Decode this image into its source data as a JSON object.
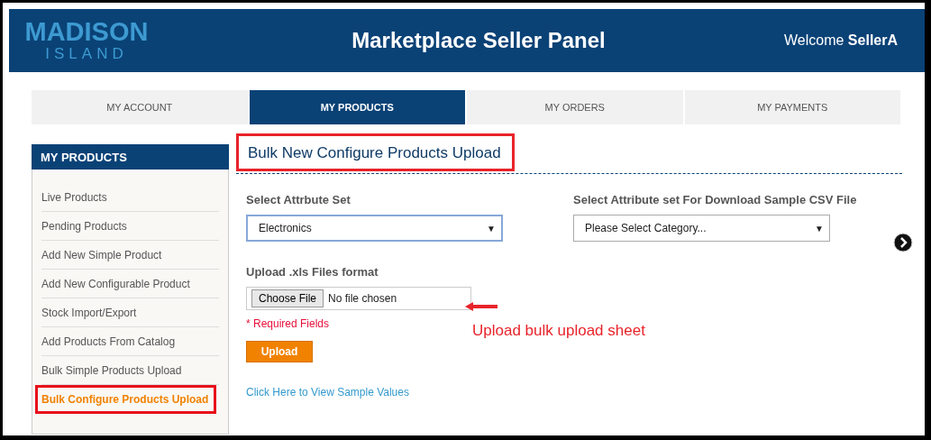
{
  "header": {
    "logo_top": "MADISON",
    "logo_bottom": "ISLAND",
    "title": "Marketplace Seller Panel",
    "welcome": "Welcome",
    "user": "SellerA"
  },
  "tabs": [
    {
      "label": "MY ACCOUNT",
      "selected": false
    },
    {
      "label": "MY PRODUCTS",
      "selected": true
    },
    {
      "label": "MY ORDERS",
      "selected": false
    },
    {
      "label": "MY PAYMENTS",
      "selected": false
    }
  ],
  "sidebar": {
    "title": "MY PRODUCTS",
    "items": [
      {
        "label": "Live Products",
        "selected": false
      },
      {
        "label": "Pending Products",
        "selected": false
      },
      {
        "label": "Add New Simple Product",
        "selected": false
      },
      {
        "label": "Add New Configurable Product",
        "selected": false
      },
      {
        "label": "Stock Import/Export",
        "selected": false
      },
      {
        "label": "Add Products From Catalog",
        "selected": false
      },
      {
        "label": "Bulk Simple Products Upload",
        "selected": false
      },
      {
        "label": "Bulk Configure Products Upload",
        "selected": true
      }
    ]
  },
  "page": {
    "title": "Bulk New Configure Products Upload",
    "title_highlighted": true,
    "fields": [
      {
        "label": "Select Attrbute Set",
        "value": "Electronics",
        "caret": "▼",
        "focused": true
      },
      {
        "label": "Select Attribute set For Download Sample CSV File",
        "value": "Please Select Category...",
        "caret": "▼",
        "focused": false
      }
    ],
    "upload_label": "Upload .xls Files format",
    "choose_button": "Choose File",
    "file_status": "No file chosen",
    "required": "* Required Fields",
    "upload_button": "Upload",
    "sample_link": "Click Here to View Sample Values",
    "annotation": "Upload bulk upload sheet"
  }
}
